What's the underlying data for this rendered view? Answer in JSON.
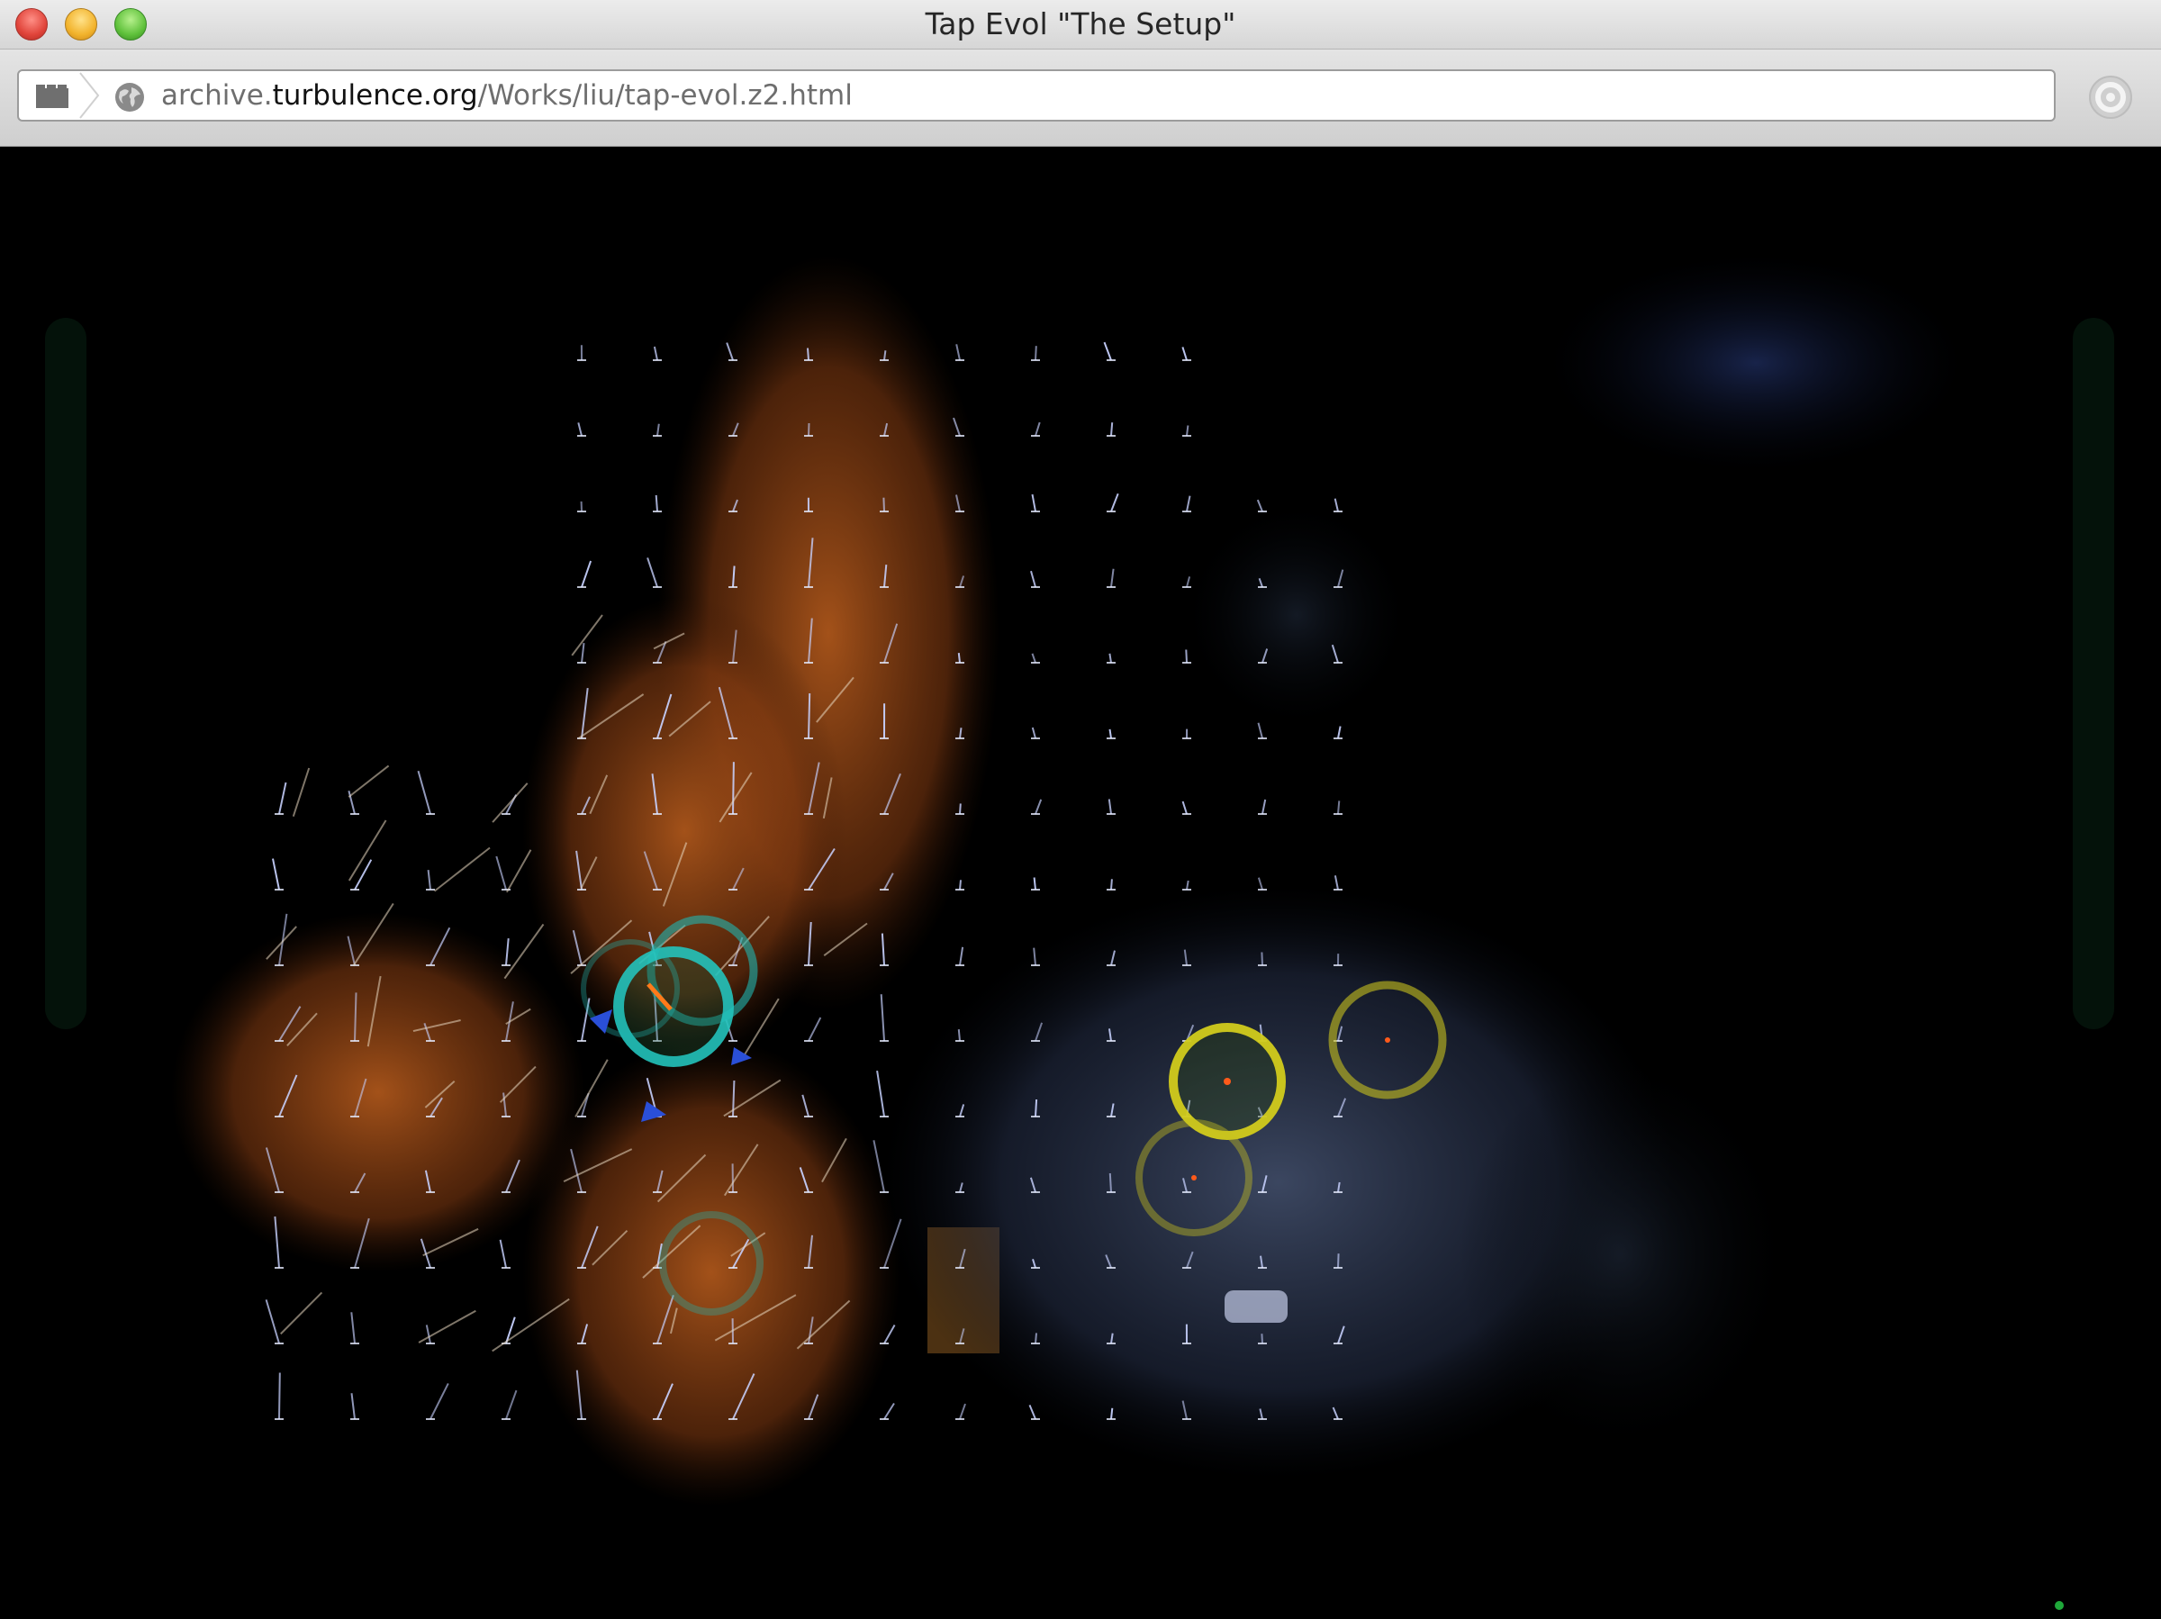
{
  "window": {
    "title": "Tap Evol \"The Setup\""
  },
  "toolbar": {
    "url_prefix": "archive.",
    "url_host": "turbulence.org",
    "url_path": "/Works/liu/tap-evol.z2.html"
  },
  "icons": {
    "tabs": "tabs-icon",
    "site": "globe-icon",
    "reader": "reader-icon"
  },
  "colors": {
    "background": "#000000",
    "flow_lines": "#c8d2ff",
    "teal_ring": "#1fb5b0",
    "yellow_ring": "#c8c21e",
    "orange_region": "#b8561a",
    "blue_region": "#33405c"
  }
}
